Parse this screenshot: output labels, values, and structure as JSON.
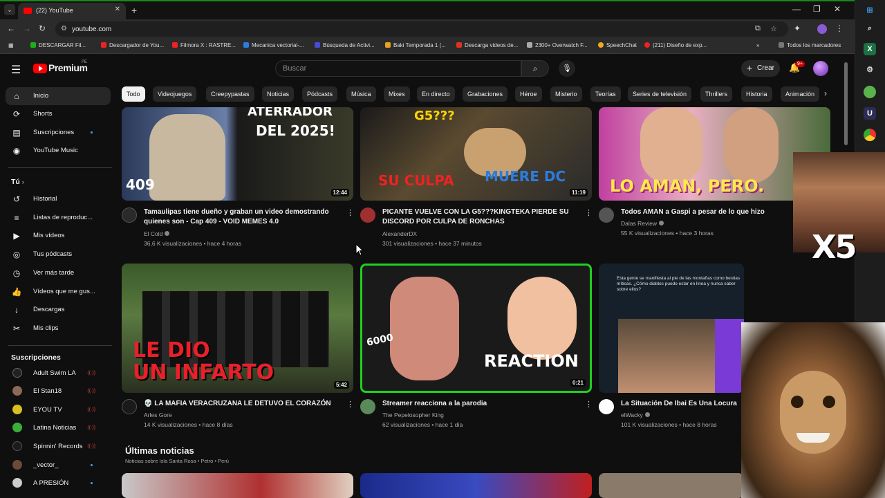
{
  "browser": {
    "tab_title": "(22) YouTube",
    "url": "youtube.com",
    "bookmarks": [
      "DESCARGAR Fil...",
      "Descargador de You...",
      "Filmora X : RASTRE...",
      "Mecanica vectorial-...",
      "Búsqueda de Activi...",
      "Baki Temporada 1 (...",
      "Descarga videos de...",
      "2300+ Overwatch F...",
      "SpeechChat",
      "(211) Diseño de exp...",
      "Todos los marcadores"
    ]
  },
  "header": {
    "logo_text": "Premium",
    "logo_region": "PE",
    "search_placeholder": "Buscar",
    "create_label": "Crear",
    "notif_count": "9+"
  },
  "chips": [
    "Todo",
    "Videojuegos",
    "Creepypastas",
    "Noticias",
    "Pódcasts",
    "Música",
    "Mixes",
    "En directo",
    "Grabaciones",
    "Héroe",
    "Misterio",
    "Teorías",
    "Series de televisión",
    "Thrillers",
    "Historia",
    "Animación"
  ],
  "sidebar": {
    "main": [
      "Inicio",
      "Shorts",
      "Suscripciones",
      "YouTube Music"
    ],
    "you_heading": "Tú",
    "you": [
      "Historial",
      "Listas de reproduc...",
      "Mis vídeos",
      "Tus pódcasts",
      "Ver más tarde",
      "Vídeos que me gus...",
      "Descargas",
      "Mis clips"
    ],
    "subs_heading": "Suscripciones",
    "subs": [
      "Adult Swim LA",
      "El Stan18",
      "EYOU TV",
      "Latina Noticias",
      "Spinnin' Records",
      "_vector_",
      "A PRESIÓN"
    ]
  },
  "videos": [
    {
      "title": "Tamaulipas tiene dueño y graban un video demostrando quienes son - Cap 409 - VOID MEMES 4.0",
      "channel": "El Cold",
      "meta": "36,6 K visualizaciones • hace 4 horas",
      "duration": "12:44",
      "thumb_text_1": "ATERRADOR",
      "thumb_text_2": "DEL 2025!",
      "thumb_text_3": "409"
    },
    {
      "title": "PICANTE VUELVE CON LA G5???KINGTEKA PIERDE SU DISCORD POR CULPA DE RONCHAS",
      "channel": "AlexanderDX",
      "meta": "301 visualizaciones • hace 37 minutos",
      "duration": "11:19",
      "thumb_text_1": "G5???",
      "thumb_text_2": "SU CULPA",
      "thumb_text_3": "MUERE DC"
    },
    {
      "title": "Todos AMAN a Gaspi a pesar de lo que hizo",
      "channel": "Dalas Review",
      "meta": "55 K visualizaciones • hace 3 horas",
      "duration": "",
      "thumb_text_1": "LO AMAN, PERO."
    },
    {
      "title": "💀 LA MAFIA VERACRUZANA LE DETUVO EL CORAZÓN",
      "channel": "Arles Gore",
      "meta": "14 K visualizaciones • hace 8 días",
      "duration": "5:42",
      "thumb_text_1": "LE DIO",
      "thumb_text_2": "UN INFARTO"
    },
    {
      "title": "Streamer reacciona a la parodia",
      "channel": "The Pepelosopher King",
      "meta": "62 visualizaciones • hace 1 día",
      "duration": "0:21",
      "thumb_text_1": "REACTION",
      "thumb_text_2": "6000"
    },
    {
      "title": "La Situación De Ibai Es Una Locura",
      "channel": "elWacky",
      "meta": "101 K visualizaciones • hace 8 horas",
      "duration": "",
      "thumb_text_1": "Esta gente se manifiesta al pie de las montañas como bestias míticas. ¿Cómo diablos puedo estar en línea y nunca saber sobre ellos?"
    }
  ],
  "news": {
    "title": "Últimas noticias",
    "subtitle": "Noticias sobre Isla Santa Rosa • Petro • Perú"
  },
  "overlay": {
    "multiplier": "X5"
  },
  "colors": {
    "accent": "#ff0000",
    "background": "#0f0f0f",
    "highlight": "#1ed11e"
  }
}
